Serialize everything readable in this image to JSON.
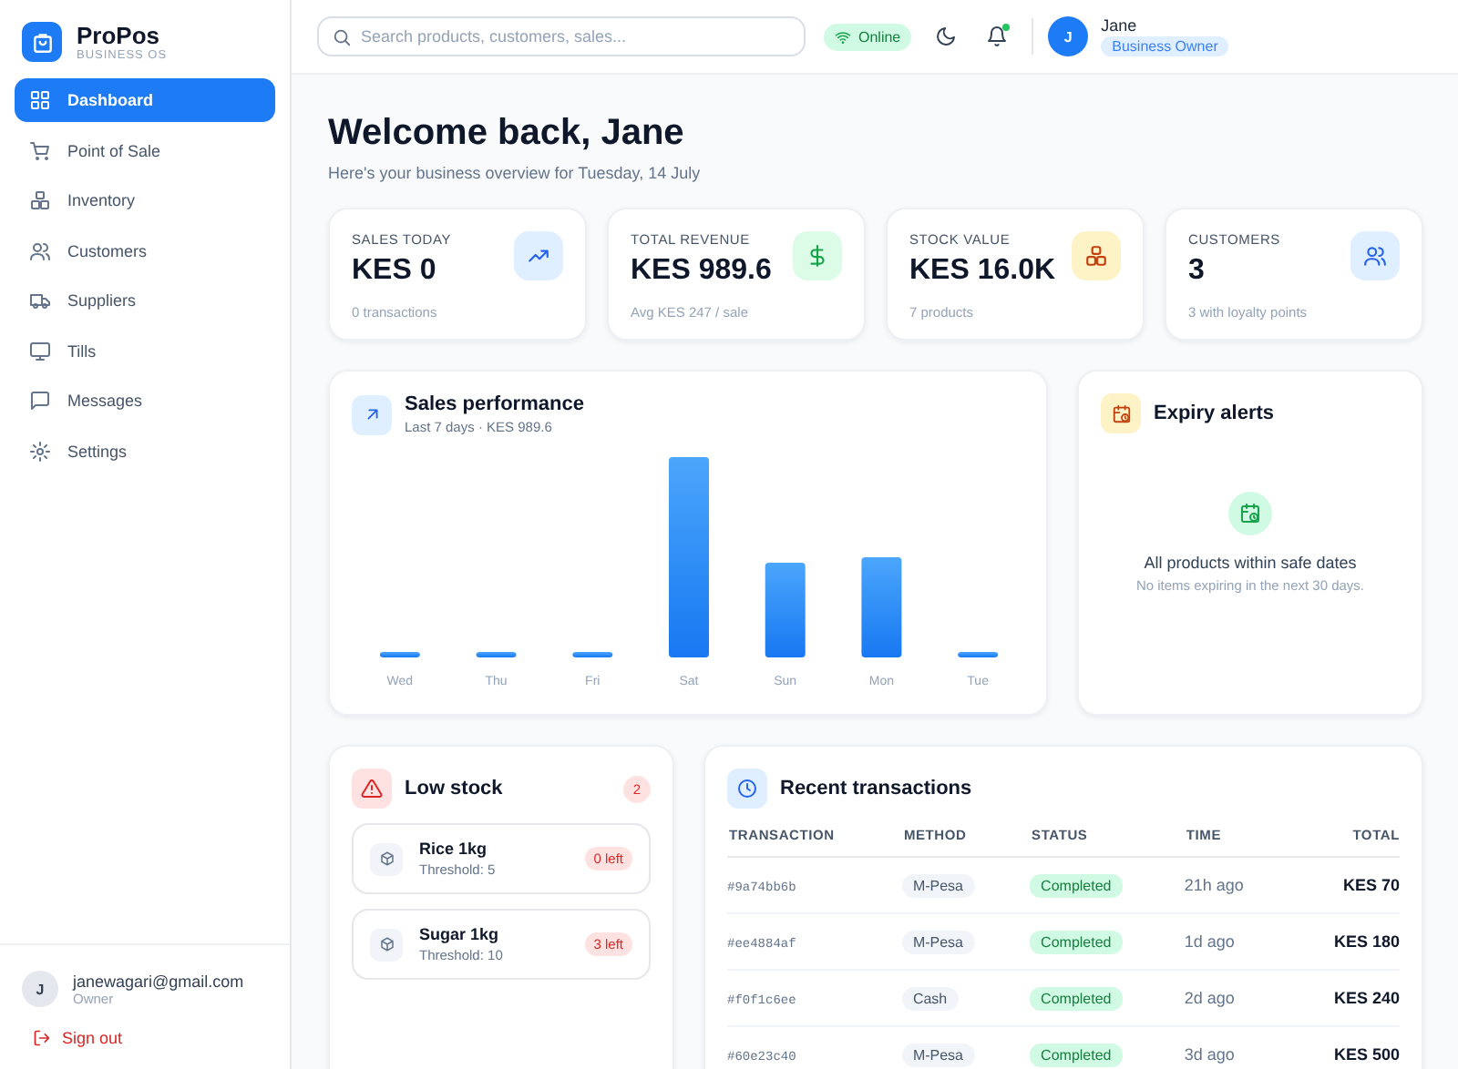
{
  "brand": {
    "name": "ProPos",
    "tagline": "BUSINESS OS"
  },
  "nav": [
    {
      "label": "Dashboard",
      "kind": "grid",
      "selected": true
    },
    {
      "label": "Point of Sale",
      "kind": "cart",
      "selected": false
    },
    {
      "label": "Inventory",
      "kind": "boxes",
      "selected": false
    },
    {
      "label": "Customers",
      "kind": "users",
      "selected": false
    },
    {
      "label": "Suppliers",
      "kind": "truck",
      "selected": false
    },
    {
      "label": "Tills",
      "kind": "monitor",
      "selected": false
    },
    {
      "label": "Messages",
      "kind": "chat",
      "selected": false
    },
    {
      "label": "Settings",
      "kind": "gear",
      "selected": false
    }
  ],
  "account": {
    "initial": "J",
    "email": "janewagari@gmail.com",
    "role": "Owner",
    "sign_out": "Sign out"
  },
  "search": {
    "placeholder": "Search products, customers, sales..."
  },
  "connection": {
    "label": "Online",
    "online": true
  },
  "notifications": {
    "unread": true
  },
  "profile": {
    "initial": "J",
    "name": "Jane",
    "role": "Business Owner"
  },
  "heading": "Welcome back, Jane",
  "subheading": "Here's your business overview for Tuesday, 14 July",
  "stats": [
    {
      "kind": "trend",
      "label": "SALES TODAY",
      "value": "KES 0",
      "note": "0 transactions"
    },
    {
      "kind": "money",
      "label": "TOTAL REVENUE",
      "value": "KES 989.6",
      "note": "Avg KES 247 / sale"
    },
    {
      "kind": "stock",
      "label": "STOCK VALUE",
      "value": "KES 16.0K",
      "note": "7 products"
    },
    {
      "kind": "users",
      "label": "CUSTOMERS",
      "value": "3",
      "note": "3 with loyalty points"
    }
  ],
  "sales_chart": {
    "title": "Sales performance",
    "subtitle": "Last 7 days · KES 989.6",
    "days": [
      "Wed",
      "Thu",
      "Fri",
      "Sat",
      "Sun",
      "Mon",
      "Tue"
    ]
  },
  "expiry": {
    "title": "Expiry alerts",
    "message": "All products within safe dates",
    "note": "No items expiring in the next 30 days."
  },
  "low_stock": {
    "title": "Low stock",
    "count": "2",
    "items": [
      {
        "name": "Rice 1kg",
        "threshold": "Threshold: 5",
        "left": "0 left"
      },
      {
        "name": "Sugar 1kg",
        "threshold": "Threshold: 10",
        "left": "3 left"
      }
    ]
  },
  "transactions": {
    "title": "Recent transactions",
    "columns": [
      "TRANSACTION",
      "METHOD",
      "STATUS",
      "TIME",
      "TOTAL"
    ],
    "rows": [
      {
        "id": "#9a74bb6b",
        "method": "M-Pesa",
        "status": "Completed",
        "time": "21h ago",
        "total": "KES 70"
      },
      {
        "id": "#ee4884af",
        "method": "M-Pesa",
        "status": "Completed",
        "time": "1d ago",
        "total": "KES 180"
      },
      {
        "id": "#f0f1c6ee",
        "method": "Cash",
        "status": "Completed",
        "time": "2d ago",
        "total": "KES 240"
      },
      {
        "id": "#60e23c40",
        "method": "M-Pesa",
        "status": "Completed",
        "time": "3d ago",
        "total": "KES 500"
      }
    ]
  }
}
